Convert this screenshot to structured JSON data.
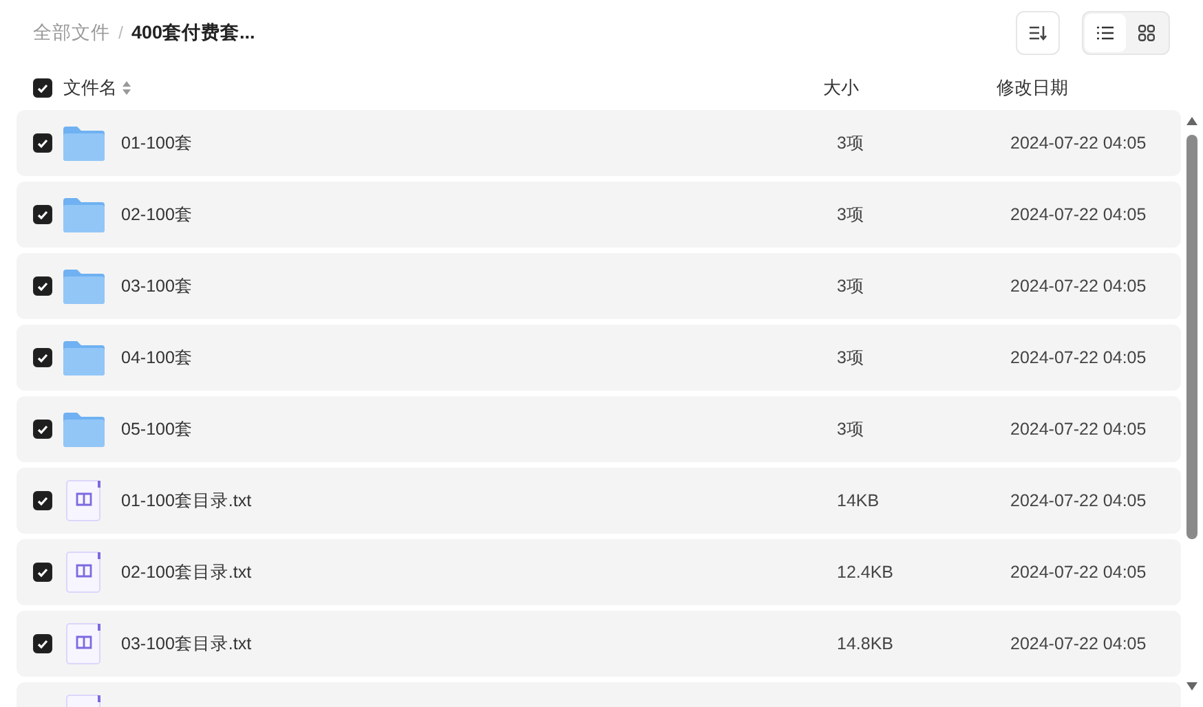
{
  "breadcrumb": [
    {
      "label": "全部文件",
      "current": false
    },
    {
      "separator": "/",
      "label": "400套付费套...",
      "current": true
    }
  ],
  "view_toggle": [
    {
      "kind": "list",
      "selected": true
    },
    {
      "kind": "grid",
      "selected": false
    }
  ],
  "header": {
    "checked": true,
    "name": "文件名",
    "size": "大小",
    "date": "修改日期"
  },
  "rows": [
    {
      "kind": "folder",
      "checked": true,
      "name": "01-100套",
      "size": "3项",
      "date": "2024-07-22 04:05"
    },
    {
      "kind": "folder",
      "checked": true,
      "name": "02-100套",
      "size": "3项",
      "date": "2024-07-22 04:05"
    },
    {
      "kind": "folder",
      "checked": true,
      "name": "03-100套",
      "size": "3项",
      "date": "2024-07-22 04:05"
    },
    {
      "kind": "folder",
      "checked": true,
      "name": "04-100套",
      "size": "3项",
      "date": "2024-07-22 04:05"
    },
    {
      "kind": "folder",
      "checked": true,
      "name": "05-100套",
      "size": "3项",
      "date": "2024-07-22 04:05"
    },
    {
      "kind": "txt",
      "checked": true,
      "name": "01-100套目录.txt",
      "size": "14KB",
      "date": "2024-07-22 04:05"
    },
    {
      "kind": "txt",
      "checked": true,
      "name": "02-100套目录.txt",
      "size": "12.4KB",
      "date": "2024-07-22 04:05"
    },
    {
      "kind": "txt",
      "checked": true,
      "name": "03-100套目录.txt",
      "size": "14.8KB",
      "date": "2024-07-22 04:05"
    },
    {
      "kind": "txt"
    }
  ]
}
